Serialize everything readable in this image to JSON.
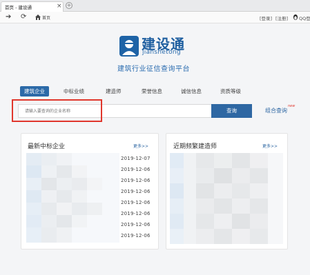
{
  "browser": {
    "tab_title": "首页 - 建设通",
    "tab_close": "×",
    "new_tab": "+",
    "home_label": "首页",
    "login": "[登录]",
    "register": "[注册]",
    "qq_label": "QQ登"
  },
  "logo": {
    "title": "建设通",
    "subtitle": "jianshetong",
    "slogan": "建筑行业征信查询平台",
    "brand_color": "#1f5fa0"
  },
  "tabs": [
    "建筑企业",
    "中标业绩",
    "建造师",
    "荣誉信息",
    "诚信信息",
    "资质等级"
  ],
  "search": {
    "placeholder": "请输入要查询的企业名称",
    "button_label": "查询",
    "combo_label": "组合查询",
    "combo_badge": "new",
    "accent_color": "#2e67a3",
    "highlight_color": "#e0362c"
  },
  "panels": {
    "left": {
      "title": "最新中标企业",
      "more": "更多>>",
      "dates": [
        "2019-12-07",
        "2019-12-06",
        "2019-12-06",
        "2019-12-06",
        "2019-12-06",
        "2019-12-06",
        "2019-12-06",
        "2019-12-06"
      ]
    },
    "right": {
      "title": "近期频繁建造师",
      "more": "更多>>"
    }
  }
}
